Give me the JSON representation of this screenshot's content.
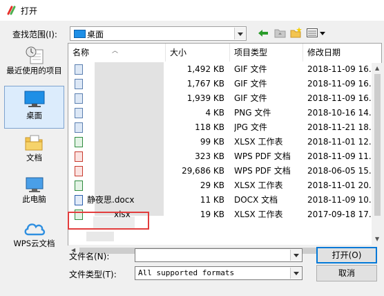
{
  "window": {
    "title": "打开"
  },
  "toolbar": {
    "look_in_label": "查找范围(I):",
    "look_in_value": "桌面"
  },
  "places": [
    {
      "label": "最近使用的项目",
      "icon": "recent-documents-icon"
    },
    {
      "label": "桌面",
      "icon": "desktop-icon",
      "selected": true
    },
    {
      "label": "文档",
      "icon": "documents-folder-icon"
    },
    {
      "label": "此电脑",
      "icon": "this-pc-icon"
    },
    {
      "label": "WPS云文档",
      "icon": "wps-cloud-icon"
    }
  ],
  "columns": {
    "name": "名称",
    "size": "大小",
    "type": "项目类型",
    "modified": "修改日期"
  },
  "files": [
    {
      "name": "",
      "size": "1,492 KB",
      "type": "GIF 文件",
      "modified": "2018-11-09 16.",
      "icon": "image-file-icon"
    },
    {
      "name": "",
      "size": "1,767 KB",
      "type": "GIF 文件",
      "modified": "2018-11-09 16.",
      "icon": "image-file-icon"
    },
    {
      "name": "",
      "size": "1,939 KB",
      "type": "GIF 文件",
      "modified": "2018-11-09 16.",
      "icon": "image-file-icon"
    },
    {
      "name": "",
      "size": "4 KB",
      "type": "PNG 文件",
      "modified": "2018-10-16 14.",
      "icon": "image-file-icon"
    },
    {
      "name": "",
      "size": "118 KB",
      "type": "JPG 文件",
      "modified": "2018-11-21 18.",
      "icon": "image-file-icon"
    },
    {
      "name": "",
      "size": "99 KB",
      "type": "XLSX 工作表",
      "modified": "2018-11-01 12.",
      "icon": "xlsx-file-icon"
    },
    {
      "name": "",
      "size": "323 KB",
      "type": "WPS PDF 文档",
      "modified": "2018-11-09 11.",
      "icon": "pdf-file-icon"
    },
    {
      "name": "",
      "size": "29,686 KB",
      "type": "WPS PDF 文档",
      "modified": "2018-06-05 15.",
      "icon": "pdf-file-icon"
    },
    {
      "name": "",
      "size": "29 KB",
      "type": "XLSX 工作表",
      "modified": "2018-11-01 20.",
      "icon": "xlsx-file-icon"
    },
    {
      "name": "静夜思.docx",
      "size": "11 KB",
      "type": "DOCX 文档",
      "modified": "2018-11-09 10.",
      "icon": "docx-file-icon"
    },
    {
      "name": "xlsx",
      "size": "19 KB",
      "type": "XLSX 工作表",
      "modified": "2017-09-18 17.",
      "icon": "xlsx-file-icon"
    }
  ],
  "footer": {
    "filename_label": "文件名(N):",
    "filename_value": "",
    "filetype_label": "文件类型(T):",
    "filetype_value": "All supported formats",
    "open_button": "打开(O)",
    "cancel_button": "取消"
  }
}
